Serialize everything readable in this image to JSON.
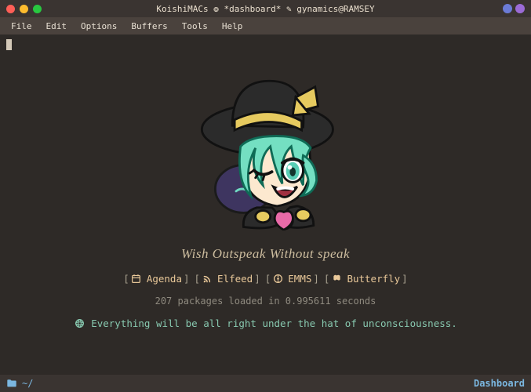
{
  "window": {
    "title": "KoishiMACs ❂ *dashboard* ✎ gynamics@RAMSEY"
  },
  "menubar": {
    "items": [
      "File",
      "Edit",
      "Options",
      "Buffers",
      "Tools",
      "Help"
    ]
  },
  "dashboard": {
    "tagline": "Wish Outspeak  Without speak",
    "nav": [
      {
        "icon": "calendar-icon",
        "label": "Agenda"
      },
      {
        "icon": "rss-icon",
        "label": "Elfeed"
      },
      {
        "icon": "disc-icon",
        "label": "EMMS"
      },
      {
        "icon": "butterfly-icon",
        "label": "Butterfly"
      }
    ],
    "stats": "207 packages loaded in 0.995611 seconds",
    "fortune_icon": "globe-icon",
    "fortune": "Everything will be all right under the hat of unconsciousness."
  },
  "modeline": {
    "cwd": "~/",
    "major_mode": "Dashboard"
  }
}
